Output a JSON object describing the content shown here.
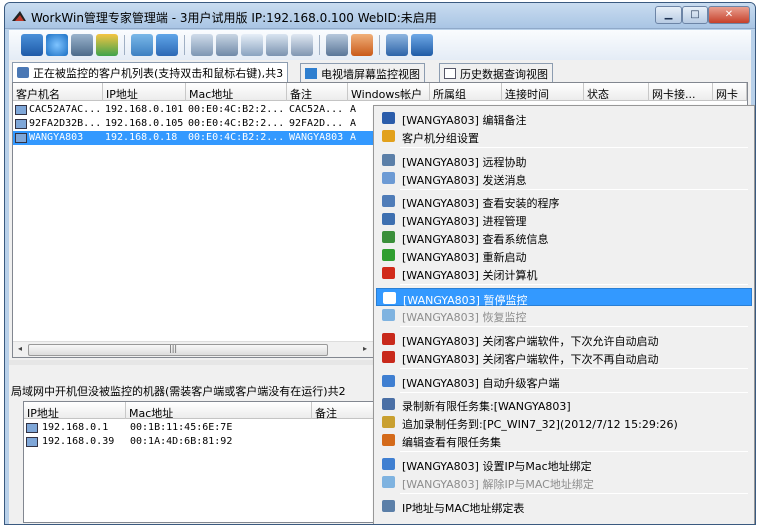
{
  "window": {
    "title": "WorkWin管理专家管理端 - 3用户试用版 IP:192.168.0.100 WebID:未启用",
    "min_glyph": "▁",
    "max_glyph": "□",
    "close_glyph": "✕"
  },
  "tabs": [
    {
      "label": "正在被监控的客户机列表(支持双击和鼠标右键),共3"
    },
    {
      "label": "电视墙屏幕监控视图"
    },
    {
      "label": "历史数据查询视图"
    }
  ],
  "client_table": {
    "columns": [
      "客户机名",
      "IP地址",
      "Mac地址",
      "备注",
      "Windows帐户",
      "所属组",
      "连接时间",
      "状态",
      "网卡接...",
      "网卡"
    ],
    "rows": [
      {
        "name": "CAC52A7AC...",
        "ip": "192.168.0.101",
        "mac": "00:E0:4C:B2:2...",
        "note": "CAC52A...",
        "account": "A",
        "selected": false
      },
      {
        "name": "92FA2D32B...",
        "ip": "192.168.0.105",
        "mac": "00:E0:4C:B2:2...",
        "note": "92FA2D...",
        "account": "A",
        "selected": false
      },
      {
        "name": "WANGYA803",
        "ip": "192.168.0.18",
        "mac": "00:E0:4C:B2:2...",
        "note": "WANGYA803",
        "account": "A",
        "selected": true
      }
    ],
    "scroll_left": "◂",
    "scroll_right": "▸",
    "scroll_grip": "|||"
  },
  "lan_section": {
    "label": "局域网中开机但没被监控的机器(需装客户端或客户端没有在运行)共2",
    "columns": [
      "IP地址",
      "Mac地址",
      "备注"
    ],
    "rows": [
      {
        "ip": "192.168.0.1",
        "mac": "00:1B:11:45:6E:7E"
      },
      {
        "ip": "192.168.0.39",
        "mac": "00:1A:4D:6B:81:92"
      }
    ]
  },
  "context_menu": {
    "items": [
      {
        "label": "[WANGYA803] 编辑备注",
        "icon": "pencil-icon",
        "color": "#2a5caa"
      },
      {
        "label": "客户机分组设置",
        "icon": "group-icon",
        "color": "#e2a11c"
      },
      {
        "label": "[WANGYA803] 远程协助",
        "icon": "monitor-icon",
        "color": "#5b7fa8"
      },
      {
        "label": "[WANGYA803] 发送消息",
        "icon": "message-icon",
        "color": "#6c9ad4"
      },
      {
        "label": "[WANGYA803] 查看安装的程序",
        "icon": "programs-icon",
        "color": "#4f7cb8"
      },
      {
        "label": "[WANGYA803] 进程管理",
        "icon": "process-icon",
        "color": "#3d6fb0"
      },
      {
        "label": "[WANGYA803] 查看系统信息",
        "icon": "sysinfo-icon",
        "color": "#3a8f3a"
      },
      {
        "label": "[WANGYA803] 重新启动",
        "icon": "restart-icon",
        "color": "#2f9e2f"
      },
      {
        "label": "[WANGYA803] 关闭计算机",
        "icon": "power-icon",
        "color": "#d12a1a"
      },
      {
        "label": "[WANGYA803] 暂停监控",
        "icon": "pause-icon",
        "color": "#ffffff"
      },
      {
        "label": "[WANGYA803] 恢复监控",
        "icon": "play-icon",
        "color": "#7fb3e0"
      },
      {
        "label": "[WANGYA803] 关闭客户端软件，下次允许自动启动",
        "icon": "close-x-icon",
        "color": "#c8281a"
      },
      {
        "label": "[WANGYA803] 关闭客户端软件，下次不再自动启动",
        "icon": "close-doc-icon",
        "color": "#c8281a"
      },
      {
        "label": "[WANGYA803] 自动升级客户端",
        "icon": "upgrade-icon",
        "color": "#3f7fd1"
      },
      {
        "label": "录制新有限任务集:[WANGYA803]",
        "icon": "record-icon",
        "color": "#4a6fa5"
      },
      {
        "label": "追加录制任务到:[PC_WIN7_32](2012/7/12 15:29:26)",
        "icon": "append-icon",
        "color": "#c9a030"
      },
      {
        "label": "编辑查看有限任务集",
        "icon": "edit-tasks-icon",
        "color": "#d46a1a"
      },
      {
        "label": "[WANGYA803] 设置IP与Mac地址绑定",
        "icon": "lock-icon",
        "color": "#3f7fd1"
      },
      {
        "label": "[WANGYA803] 解除IP与MAC地址绑定",
        "icon": "unlock-icon",
        "color": "#7fb3e0"
      },
      {
        "label": "IP地址与MAC地址绑定表",
        "icon": "table-icon",
        "color": "#5b7fa8"
      }
    ]
  }
}
